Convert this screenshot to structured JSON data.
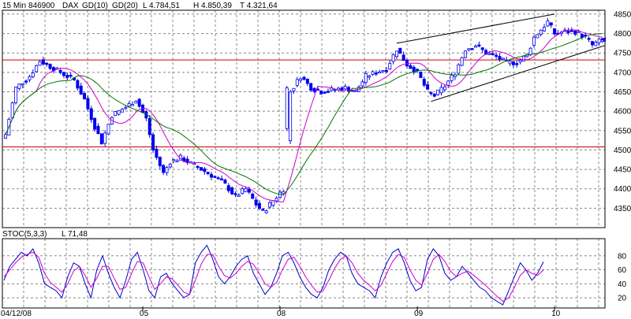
{
  "header": {
    "timeframe": "15 Min",
    "symbol_id": "846900",
    "symbol": "DAX",
    "gd10_label": "GD(10)",
    "gd20_label": "GD(20)",
    "last": "L 4.784,51",
    "high": "H 4.850,39",
    "low": "T 4.321,64"
  },
  "indicator": {
    "name": "STOC(5,3,3)",
    "last": "L 71,48"
  },
  "colors": {
    "candle": "#0000ee",
    "gd10": "#cc00cc",
    "gd20": "#007700",
    "hline": "#cc0000",
    "trendline": "#000000",
    "stoch_k": "#0000cc",
    "stoch_d": "#cc00cc",
    "grid": "#888888",
    "marker": "#0000cc"
  },
  "chart_data": [
    {
      "type": "candlestick",
      "ylim": [
        4300,
        4860
      ],
      "y_ticks": [
        "4850",
        "4800",
        "4750",
        "4700",
        "4650",
        "4600",
        "4550",
        "4500",
        "4450",
        "4400",
        "4350"
      ],
      "x_tick_labels": [
        {
          "label": "04/12/08",
          "bar": 0
        },
        {
          "label": "05",
          "bar": 40
        },
        {
          "label": "08",
          "bar": 80
        },
        {
          "label": "09",
          "bar": 120
        },
        {
          "label": "10",
          "bar": 160
        }
      ],
      "bar_count": 175,
      "last_marker": 4784.51,
      "horizontal_lines": [
        4732,
        4508
      ],
      "trendlines": [
        {
          "x1": 114,
          "y1": 4775,
          "x2": 160,
          "y2": 4850
        },
        {
          "x1": 124,
          "y1": 4625,
          "x2": 203,
          "y2": 4850
        }
      ],
      "key_points": [
        [
          0,
          4540
        ],
        [
          3,
          4660
        ],
        [
          7,
          4690
        ],
        [
          10,
          4730
        ],
        [
          12,
          4720
        ],
        [
          16,
          4700
        ],
        [
          20,
          4680
        ],
        [
          23,
          4630
        ],
        [
          26,
          4560
        ],
        [
          28,
          4520
        ],
        [
          31,
          4590
        ],
        [
          35,
          4610
        ],
        [
          38,
          4630
        ],
        [
          41,
          4580
        ],
        [
          43,
          4500
        ],
        [
          46,
          4440
        ],
        [
          48,
          4470
        ],
        [
          51,
          4480
        ],
        [
          55,
          4460
        ],
        [
          59,
          4440
        ],
        [
          63,
          4420
        ],
        [
          67,
          4380
        ],
        [
          70,
          4400
        ],
        [
          73,
          4360
        ],
        [
          75,
          4340
        ],
        [
          78,
          4370
        ],
        [
          81,
          4400
        ],
        [
          83,
          4650
        ],
        [
          86,
          4690
        ],
        [
          89,
          4660
        ],
        [
          92,
          4650
        ],
        [
          95,
          4655
        ],
        [
          99,
          4660
        ],
        [
          102,
          4650
        ],
        [
          105,
          4690
        ],
        [
          108,
          4700
        ],
        [
          111,
          4710
        ],
        [
          114,
          4760
        ],
        [
          117,
          4720
        ],
        [
          120,
          4700
        ],
        [
          123,
          4650
        ],
        [
          125,
          4640
        ],
        [
          128,
          4665
        ],
        [
          131,
          4700
        ],
        [
          134,
          4760
        ],
        [
          137,
          4770
        ],
        [
          140,
          4750
        ],
        [
          143,
          4740
        ],
        [
          146,
          4725
        ],
        [
          149,
          4725
        ],
        [
          152,
          4745
        ],
        [
          154,
          4790
        ],
        [
          156,
          4810
        ],
        [
          158,
          4830
        ],
        [
          160,
          4800
        ],
        [
          163,
          4805
        ],
        [
          166,
          4805
        ],
        [
          169,
          4790
        ],
        [
          171,
          4770
        ],
        [
          174,
          4785
        ]
      ]
    },
    {
      "type": "line",
      "title": "STOC(5,3,3)",
      "ylim": [
        10,
        100
      ],
      "y_ticks": [
        "80",
        "60",
        "40",
        "20"
      ],
      "series": [
        {
          "key": "k",
          "values": [
            45,
            65,
            75,
            85,
            80,
            90,
            70,
            40,
            35,
            30,
            20,
            50,
            70,
            65,
            40,
            20,
            60,
            80,
            55,
            35,
            20,
            45,
            75,
            85,
            60,
            30,
            20,
            50,
            55,
            40,
            30,
            20,
            25,
            70,
            85,
            95,
            75,
            50,
            40,
            50,
            65,
            75,
            80,
            55,
            40,
            25,
            35,
            55,
            80,
            85,
            70,
            50,
            35,
            25,
            20,
            35,
            60,
            75,
            85,
            80,
            55,
            40,
            35,
            30,
            20,
            50,
            70,
            85,
            90,
            70,
            45,
            30,
            35,
            75,
            90,
            80,
            55,
            45,
            50,
            65,
            55,
            45,
            35,
            30,
            20,
            15,
            10,
            30,
            50,
            70,
            60,
            45,
            55,
            71.48
          ]
        },
        {
          "key": "d",
          "values": [
            50,
            60,
            70,
            78,
            82,
            85,
            78,
            55,
            42,
            35,
            28,
            40,
            58,
            65,
            52,
            35,
            48,
            65,
            65,
            48,
            32,
            35,
            55,
            72,
            70,
            50,
            32,
            40,
            50,
            47,
            38,
            28,
            25,
            45,
            68,
            82,
            82,
            65,
            52,
            48,
            55,
            65,
            72,
            68,
            55,
            40,
            35,
            42,
            60,
            75,
            78,
            65,
            50,
            38,
            28,
            30,
            45,
            62,
            75,
            80,
            70,
            55,
            45,
            38,
            30,
            38,
            55,
            72,
            82,
            78,
            60,
            45,
            38,
            55,
            75,
            82,
            72,
            58,
            50,
            55,
            58,
            52,
            45,
            38,
            30,
            22,
            15,
            20,
            35,
            52,
            60,
            55,
            52,
            60
          ]
        }
      ]
    }
  ]
}
